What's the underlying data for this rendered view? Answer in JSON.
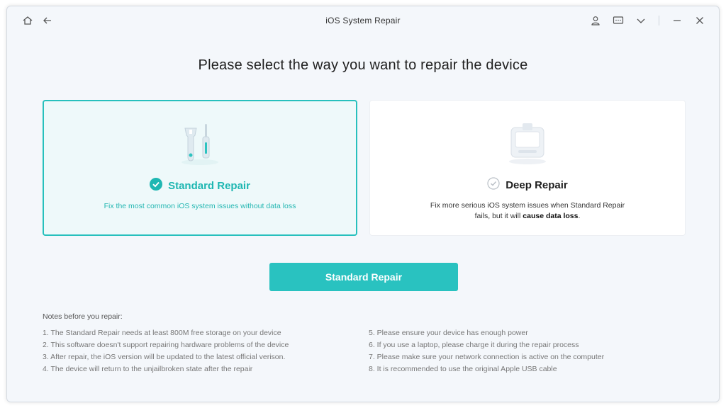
{
  "window": {
    "title": "iOS System Repair"
  },
  "titlebar": {
    "left_icons": [
      "home-icon",
      "back-arrow-icon"
    ],
    "right_icons": [
      "user-icon",
      "feedback-icon",
      "chevron-down-icon",
      "minimize-icon",
      "close-icon"
    ]
  },
  "heading": "Please select the way you want to repair the device",
  "options": {
    "standard": {
      "title": "Standard Repair",
      "description": "Fix the most common iOS system issues without data loss",
      "selected": true,
      "icon": "tools-icon"
    },
    "deep": {
      "title": "Deep Repair",
      "description_prefix": "Fix more serious iOS system issues when Standard Repair fails, but it will ",
      "description_bold": "cause data loss",
      "description_suffix": ".",
      "selected": false,
      "icon": "device-repair-icon"
    }
  },
  "action_button": {
    "label": "Standard Repair"
  },
  "notes": {
    "title": "Notes before you repair:",
    "left": [
      "1.  The Standard Repair needs at least 800M free storage on your device",
      "2.  This software doesn't support repairing hardware problems of the device",
      "3.  After repair, the iOS version will be updated to the latest official verison.",
      "4.  The device will return to the unjailbroken state after the repair"
    ],
    "right": [
      "5.  Please ensure your device has enough power",
      "6.  If you use a laptop, please charge it during the repair process",
      "7.  Please make sure your network connection is active on the computer",
      "8.  It is recommended to use the original Apple USB cable"
    ]
  },
  "colors": {
    "accent": "#29c2c0",
    "selected_card_bg": "#eef9fa",
    "window_bg": "#f4f7fb"
  }
}
